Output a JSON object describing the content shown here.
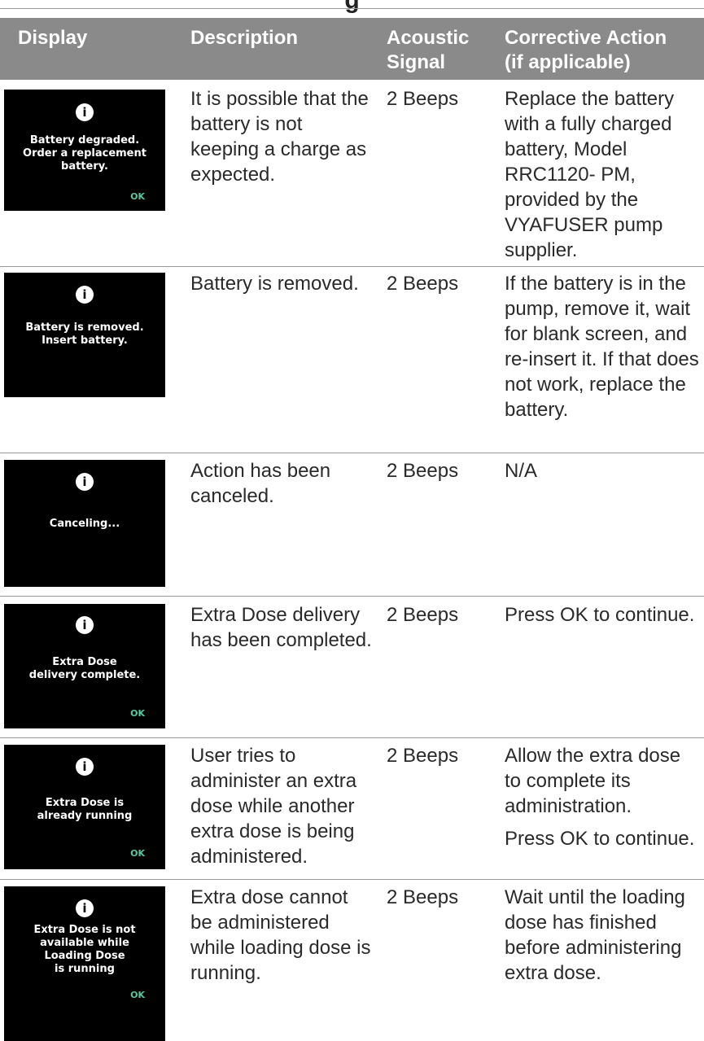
{
  "page": {
    "partial_title": "g"
  },
  "table": {
    "headers": {
      "display": "Display",
      "description": "Description",
      "signal_line1": "Acoustic",
      "signal_line2": "Signal",
      "action_line1": "Corrective Action",
      "action_line2": "(if applicable)"
    },
    "rows": [
      {
        "screen": {
          "icon": "info-icon",
          "message": "Battery degraded.\nOrder a replacement\nbattery.",
          "ok": "OK"
        },
        "description": "It is possible that the battery is not keeping a charge as expected.",
        "signal": "2 Beeps",
        "action": [
          "Replace the battery with a fully charged battery, Model RRC1120- PM, provided by the VYAFUSER pump supplier."
        ]
      },
      {
        "screen": {
          "icon": "info-icon",
          "message": "Battery is removed.\nInsert battery.",
          "ok": ""
        },
        "description": "Battery is removed.",
        "signal": "2 Beeps",
        "action": [
          "If the battery is in the pump, remove it, wait for blank screen, and re-insert it. If that does not work, replace the battery."
        ]
      },
      {
        "screen": {
          "icon": "info-icon",
          "message": "Canceling...",
          "ok": ""
        },
        "description": "Action has been canceled.",
        "signal": "2 Beeps",
        "action": [
          "N/A"
        ]
      },
      {
        "screen": {
          "icon": "info-icon",
          "message": "Extra Dose\ndelivery complete.",
          "ok": "OK"
        },
        "description": "Extra Dose delivery has been completed.",
        "signal": "2 Beeps",
        "action": [
          "Press OK to continue."
        ]
      },
      {
        "screen": {
          "icon": "info-icon",
          "message": "Extra Dose is\nalready running",
          "ok": "OK"
        },
        "description": "User tries to administer an extra dose while another extra dose is being administered.",
        "signal": "2 Beeps",
        "action": [
          "Allow the extra dose to complete its administration.",
          "Press OK to continue."
        ]
      },
      {
        "screen": {
          "icon": "info-icon",
          "message": "Extra Dose is not\navailable while\nLoading Dose\nis running",
          "ok": "OK"
        },
        "description": "Extra dose cannot be administered while loading dose is running.",
        "signal": "2 Beeps",
        "action": [
          "Wait until the loading dose has finished before administering extra dose."
        ]
      }
    ]
  }
}
